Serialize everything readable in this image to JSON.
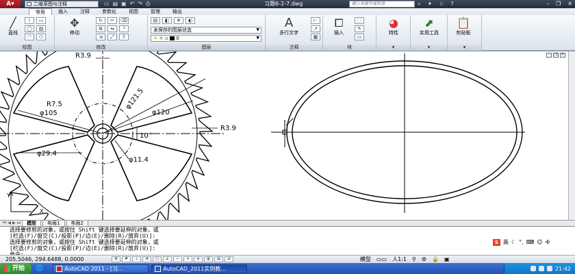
{
  "titlebar": {
    "workspace": "二维草图与注释",
    "doc_title": "习题6-2-7.dwg",
    "search_placeholder": "键入关键字或短语"
  },
  "ribbon_tabs": [
    "常用",
    "插入",
    "注释",
    "参数化",
    "视图",
    "管理",
    "输出"
  ],
  "panels": {
    "draw": {
      "title": "绘图",
      "line_label": "直线"
    },
    "modify": {
      "title": "修改",
      "move_label": "移动"
    },
    "layers": {
      "title": "图层",
      "state": "未保存的图层状态"
    },
    "annotation": {
      "title": "注释",
      "mtext_label": "多行文字"
    },
    "block": {
      "title": "块",
      "insert_label": "插入"
    },
    "properties": {
      "label": "特性"
    },
    "utilities": {
      "label": "实用工具"
    },
    "clipboard": {
      "label": "剪贴板"
    }
  },
  "drawing": {
    "dims": {
      "r39_top": "R3.9",
      "r75": "R7.5",
      "d105": "φ105",
      "d1215": "φ121.5",
      "d120": "φ120",
      "r39_right": "R3.9",
      "angle": "10°",
      "d294": "φ29.4",
      "d114": "φ11.4"
    },
    "ucs_x": "X",
    "ucs_y": "Y"
  },
  "layout_tabs": [
    "模型",
    "布局1",
    "布局2"
  ],
  "command_lines": [
    "选择要修剪的对象，或按住 Shift 键选择要延伸的对象，或",
    "[栏选(F)/窗交(C)/投影(P)/边(E)/删除(R)/放弃(U)]:",
    "选择要修剪的对象，或按住 Shift 键选择要延伸的对象，或",
    "[栏选(F)/窗交(C)/投影(P)/边(E)/删除(R)/放弃(U)]:",
    "命令:"
  ],
  "ime": {
    "lang": "英"
  },
  "statusbar": {
    "coords": "205.5046, 294.6488, 0.0000",
    "model": "模型",
    "scale": "人1:1"
  },
  "taskbar": {
    "start": "开始",
    "items": [
      "AutoCAD 2011 - [习...",
      "AutoCAD_2011实例教..."
    ],
    "clock": "21:42"
  }
}
